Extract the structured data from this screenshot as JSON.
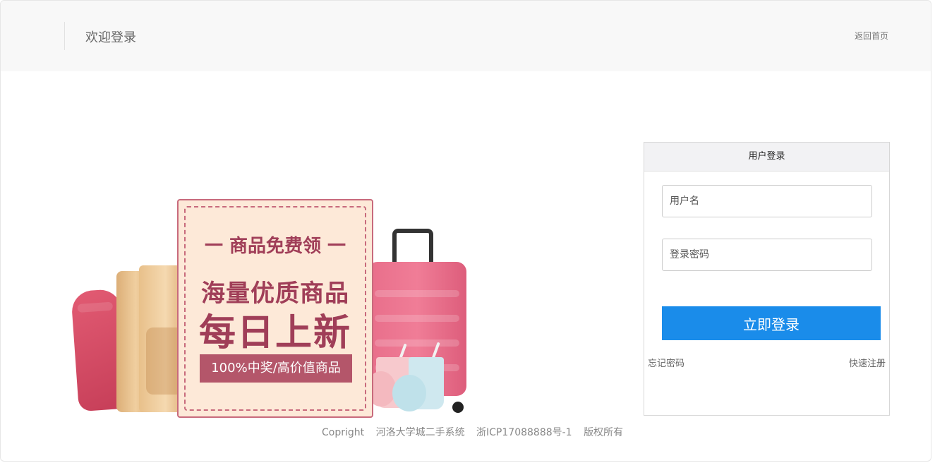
{
  "header": {
    "title": "欢迎登录",
    "home_link": "返回首页"
  },
  "banner": {
    "subtitle": "一 商品免费领 一",
    "line1": "海量优质商品",
    "line2": "每日上新",
    "tag": "100%中奖/高价值商品"
  },
  "login": {
    "heading": "用户登录",
    "username_placeholder": "用户名",
    "password_placeholder": "登录密码",
    "submit_label": "立即登录",
    "forgot_label": "忘记密码",
    "register_label": "快速注册"
  },
  "footer": {
    "copyright": "Copright",
    "system": "河洛大学城二手系统",
    "icp": "浙ICP17088888号-1",
    "rights": "版权所有"
  },
  "colors": {
    "accent": "#1a8cea",
    "promo_text": "#a03e58",
    "promo_bg": "#fde9d8"
  }
}
